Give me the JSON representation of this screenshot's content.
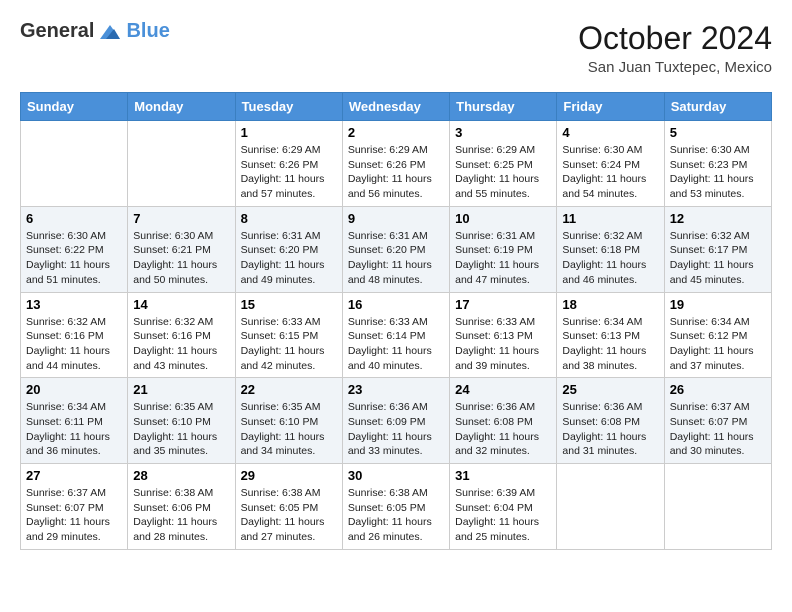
{
  "header": {
    "logo_line1": "General",
    "logo_line2": "Blue",
    "month": "October 2024",
    "location": "San Juan Tuxtepec, Mexico"
  },
  "days_of_week": [
    "Sunday",
    "Monday",
    "Tuesday",
    "Wednesday",
    "Thursday",
    "Friday",
    "Saturday"
  ],
  "weeks": [
    [
      {
        "day": "",
        "sunrise": "",
        "sunset": "",
        "daylight": ""
      },
      {
        "day": "",
        "sunrise": "",
        "sunset": "",
        "daylight": ""
      },
      {
        "day": "1",
        "sunrise": "Sunrise: 6:29 AM",
        "sunset": "Sunset: 6:26 PM",
        "daylight": "Daylight: 11 hours and 57 minutes."
      },
      {
        "day": "2",
        "sunrise": "Sunrise: 6:29 AM",
        "sunset": "Sunset: 6:26 PM",
        "daylight": "Daylight: 11 hours and 56 minutes."
      },
      {
        "day": "3",
        "sunrise": "Sunrise: 6:29 AM",
        "sunset": "Sunset: 6:25 PM",
        "daylight": "Daylight: 11 hours and 55 minutes."
      },
      {
        "day": "4",
        "sunrise": "Sunrise: 6:30 AM",
        "sunset": "Sunset: 6:24 PM",
        "daylight": "Daylight: 11 hours and 54 minutes."
      },
      {
        "day": "5",
        "sunrise": "Sunrise: 6:30 AM",
        "sunset": "Sunset: 6:23 PM",
        "daylight": "Daylight: 11 hours and 53 minutes."
      }
    ],
    [
      {
        "day": "6",
        "sunrise": "Sunrise: 6:30 AM",
        "sunset": "Sunset: 6:22 PM",
        "daylight": "Daylight: 11 hours and 51 minutes."
      },
      {
        "day": "7",
        "sunrise": "Sunrise: 6:30 AM",
        "sunset": "Sunset: 6:21 PM",
        "daylight": "Daylight: 11 hours and 50 minutes."
      },
      {
        "day": "8",
        "sunrise": "Sunrise: 6:31 AM",
        "sunset": "Sunset: 6:20 PM",
        "daylight": "Daylight: 11 hours and 49 minutes."
      },
      {
        "day": "9",
        "sunrise": "Sunrise: 6:31 AM",
        "sunset": "Sunset: 6:20 PM",
        "daylight": "Daylight: 11 hours and 48 minutes."
      },
      {
        "day": "10",
        "sunrise": "Sunrise: 6:31 AM",
        "sunset": "Sunset: 6:19 PM",
        "daylight": "Daylight: 11 hours and 47 minutes."
      },
      {
        "day": "11",
        "sunrise": "Sunrise: 6:32 AM",
        "sunset": "Sunset: 6:18 PM",
        "daylight": "Daylight: 11 hours and 46 minutes."
      },
      {
        "day": "12",
        "sunrise": "Sunrise: 6:32 AM",
        "sunset": "Sunset: 6:17 PM",
        "daylight": "Daylight: 11 hours and 45 minutes."
      }
    ],
    [
      {
        "day": "13",
        "sunrise": "Sunrise: 6:32 AM",
        "sunset": "Sunset: 6:16 PM",
        "daylight": "Daylight: 11 hours and 44 minutes."
      },
      {
        "day": "14",
        "sunrise": "Sunrise: 6:32 AM",
        "sunset": "Sunset: 6:16 PM",
        "daylight": "Daylight: 11 hours and 43 minutes."
      },
      {
        "day": "15",
        "sunrise": "Sunrise: 6:33 AM",
        "sunset": "Sunset: 6:15 PM",
        "daylight": "Daylight: 11 hours and 42 minutes."
      },
      {
        "day": "16",
        "sunrise": "Sunrise: 6:33 AM",
        "sunset": "Sunset: 6:14 PM",
        "daylight": "Daylight: 11 hours and 40 minutes."
      },
      {
        "day": "17",
        "sunrise": "Sunrise: 6:33 AM",
        "sunset": "Sunset: 6:13 PM",
        "daylight": "Daylight: 11 hours and 39 minutes."
      },
      {
        "day": "18",
        "sunrise": "Sunrise: 6:34 AM",
        "sunset": "Sunset: 6:13 PM",
        "daylight": "Daylight: 11 hours and 38 minutes."
      },
      {
        "day": "19",
        "sunrise": "Sunrise: 6:34 AM",
        "sunset": "Sunset: 6:12 PM",
        "daylight": "Daylight: 11 hours and 37 minutes."
      }
    ],
    [
      {
        "day": "20",
        "sunrise": "Sunrise: 6:34 AM",
        "sunset": "Sunset: 6:11 PM",
        "daylight": "Daylight: 11 hours and 36 minutes."
      },
      {
        "day": "21",
        "sunrise": "Sunrise: 6:35 AM",
        "sunset": "Sunset: 6:10 PM",
        "daylight": "Daylight: 11 hours and 35 minutes."
      },
      {
        "day": "22",
        "sunrise": "Sunrise: 6:35 AM",
        "sunset": "Sunset: 6:10 PM",
        "daylight": "Daylight: 11 hours and 34 minutes."
      },
      {
        "day": "23",
        "sunrise": "Sunrise: 6:36 AM",
        "sunset": "Sunset: 6:09 PM",
        "daylight": "Daylight: 11 hours and 33 minutes."
      },
      {
        "day": "24",
        "sunrise": "Sunrise: 6:36 AM",
        "sunset": "Sunset: 6:08 PM",
        "daylight": "Daylight: 11 hours and 32 minutes."
      },
      {
        "day": "25",
        "sunrise": "Sunrise: 6:36 AM",
        "sunset": "Sunset: 6:08 PM",
        "daylight": "Daylight: 11 hours and 31 minutes."
      },
      {
        "day": "26",
        "sunrise": "Sunrise: 6:37 AM",
        "sunset": "Sunset: 6:07 PM",
        "daylight": "Daylight: 11 hours and 30 minutes."
      }
    ],
    [
      {
        "day": "27",
        "sunrise": "Sunrise: 6:37 AM",
        "sunset": "Sunset: 6:07 PM",
        "daylight": "Daylight: 11 hours and 29 minutes."
      },
      {
        "day": "28",
        "sunrise": "Sunrise: 6:38 AM",
        "sunset": "Sunset: 6:06 PM",
        "daylight": "Daylight: 11 hours and 28 minutes."
      },
      {
        "day": "29",
        "sunrise": "Sunrise: 6:38 AM",
        "sunset": "Sunset: 6:05 PM",
        "daylight": "Daylight: 11 hours and 27 minutes."
      },
      {
        "day": "30",
        "sunrise": "Sunrise: 6:38 AM",
        "sunset": "Sunset: 6:05 PM",
        "daylight": "Daylight: 11 hours and 26 minutes."
      },
      {
        "day": "31",
        "sunrise": "Sunrise: 6:39 AM",
        "sunset": "Sunset: 6:04 PM",
        "daylight": "Daylight: 11 hours and 25 minutes."
      },
      {
        "day": "",
        "sunrise": "",
        "sunset": "",
        "daylight": ""
      },
      {
        "day": "",
        "sunrise": "",
        "sunset": "",
        "daylight": ""
      }
    ]
  ]
}
